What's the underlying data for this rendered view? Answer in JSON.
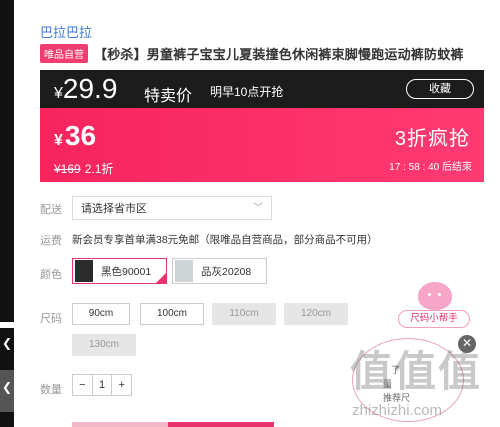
{
  "brand": "巴拉巴拉",
  "product": {
    "tag": "唯品自营",
    "title": "【秒杀】男童裤子宝宝儿夏装撞色休闲裤束脚慢跑运动裤防蚊裤"
  },
  "flash": {
    "yen": "¥",
    "price": "29.9",
    "label": "特卖价",
    "start_time": "明早10点开抢",
    "remind_button": "收藏"
  },
  "sale": {
    "yen": "¥",
    "price": "36",
    "original_price": "¥169",
    "discount": "2.1折",
    "promo": "3折疯抢",
    "countdown": "17 : 58 : 40  后结束"
  },
  "delivery": {
    "label": "配送",
    "select_placeholder": "请选择省市区"
  },
  "shipping": {
    "label": "运费",
    "text": "新会员专享首单满38元免邮（限唯品自营商品，部分商品不可用）"
  },
  "color": {
    "label": "颜色",
    "options": [
      {
        "name": "黑色90001",
        "swatch": "#2b2b2b",
        "selected": true
      },
      {
        "name": "品灰20208",
        "swatch": "#cfd4d6",
        "selected": false
      }
    ]
  },
  "size": {
    "label": "尺码",
    "options": [
      {
        "name": "90cm",
        "available": true
      },
      {
        "name": "100cm",
        "available": true
      },
      {
        "name": "110cm",
        "available": false
      },
      {
        "name": "120cm",
        "available": false
      },
      {
        "name": "130cm",
        "available": false
      }
    ]
  },
  "quantity": {
    "label": "数量",
    "minus": "−",
    "value": "1",
    "plus": "+"
  },
  "size_helper": {
    "label": "尺码小帮手"
  },
  "popup": {
    "close": "✕",
    "line1": "了",
    "line2": "量",
    "line3": "推荐尺"
  },
  "watermark": {
    "url": "zhizhizhi.com"
  },
  "colors": {
    "accent": "#e8336c",
    "sale_band": "#f7245e",
    "dark_band": "#1c1c1c",
    "link": "#3a79d8"
  }
}
